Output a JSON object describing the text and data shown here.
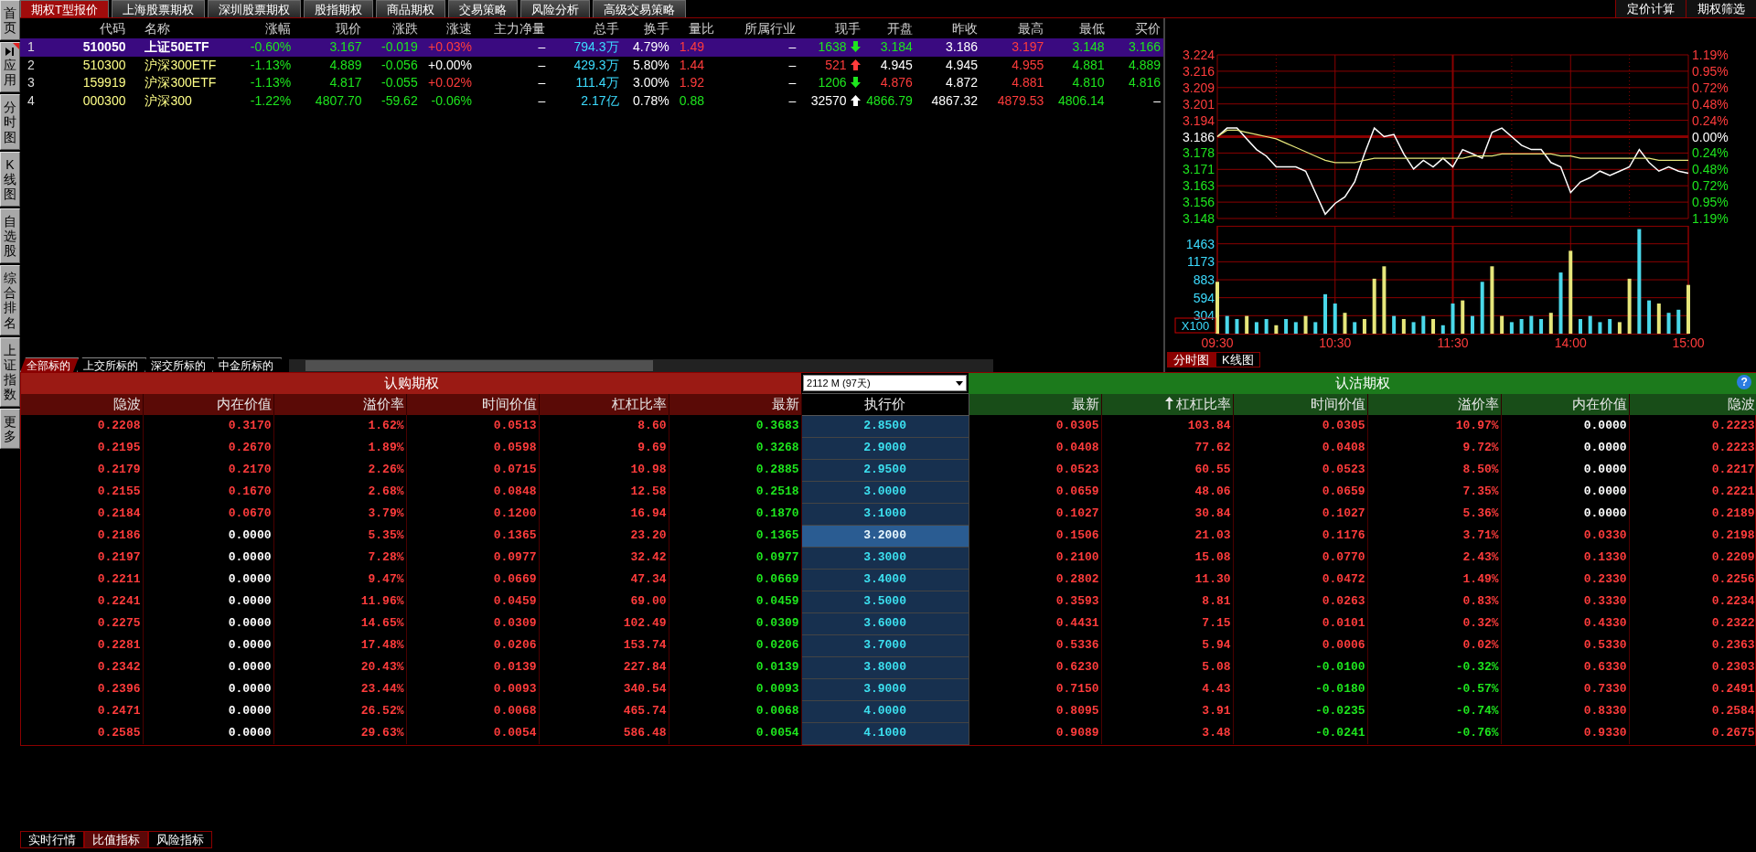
{
  "sidebar": {
    "items": [
      {
        "label": "首页",
        "kind": "tab"
      },
      {
        "label": "应用",
        "kind": "expand"
      },
      {
        "label": "分时图",
        "kind": "tab"
      },
      {
        "label": "K线图",
        "kind": "tab"
      },
      {
        "label": "自选股",
        "kind": "tab"
      },
      {
        "label": "综合排名",
        "kind": "tab"
      },
      {
        "label": "上证指数",
        "kind": "tab"
      },
      {
        "label": "更多",
        "kind": "tab"
      }
    ]
  },
  "top_tabs": [
    {
      "label": "期权T型报价",
      "selected": true
    },
    {
      "label": "上海股票期权",
      "selected": false
    },
    {
      "label": "深圳股票期权",
      "selected": false
    },
    {
      "label": "股指期权",
      "selected": false
    },
    {
      "label": "商品期权",
      "selected": false
    },
    {
      "label": "交易策略",
      "selected": false
    },
    {
      "label": "风险分析",
      "selected": false
    },
    {
      "label": "高级交易策略",
      "selected": false
    }
  ],
  "tools": [
    "定价计算",
    "期权筛选"
  ],
  "quote": {
    "columns": [
      "代码",
      "名称",
      "涨幅",
      "现价",
      "涨跌",
      "涨速",
      "主力净量",
      "总手",
      "换手",
      "量比",
      "所属行业",
      "现手",
      "开盘",
      "昨收",
      "最高",
      "最低",
      "买价"
    ],
    "rows": [
      {
        "index": "1",
        "selected": true,
        "cells": [
          {
            "text": "510050",
            "color": "#ffffff"
          },
          {
            "text": "上证50ETF",
            "color": "#ffffff"
          },
          {
            "text": "-0.60%",
            "color": "#1ee61e"
          },
          {
            "text": "3.167",
            "color": "#1ee61e"
          },
          {
            "text": "-0.019",
            "color": "#1ee61e"
          },
          {
            "text": "+0.03%",
            "color": "#ff3c3c"
          },
          {
            "text": "–",
            "color": "#ffffff"
          },
          {
            "text": "794.3万",
            "color": "#3cdcff"
          },
          {
            "text": "4.79%",
            "color": "#ffffff"
          },
          {
            "text": "1.49",
            "color": "#ff3c3c"
          },
          {
            "text": "–",
            "color": "#ffffff"
          },
          {
            "text": "1638",
            "color": "#1ee61e",
            "rising": false
          },
          {
            "text": "3.184",
            "color": "#1ee61e"
          },
          {
            "text": "3.186",
            "color": "#ffffff"
          },
          {
            "text": "3.197",
            "color": "#ff3c3c"
          },
          {
            "text": "3.148",
            "color": "#1ee61e"
          },
          {
            "text": "3.166",
            "color": "#1ee61e"
          }
        ]
      },
      {
        "index": "2",
        "selected": false,
        "cells": [
          {
            "text": "510300",
            "color": "#ffff88"
          },
          {
            "text": "沪深300ETF",
            "color": "#ffff88"
          },
          {
            "text": "-1.13%",
            "color": "#1ee61e"
          },
          {
            "text": "4.889",
            "color": "#1ee61e"
          },
          {
            "text": "-0.056",
            "color": "#1ee61e"
          },
          {
            "text": "+0.00%",
            "color": "#ffffff"
          },
          {
            "text": "–",
            "color": "#ffffff"
          },
          {
            "text": "429.3万",
            "color": "#3cdcff"
          },
          {
            "text": "5.80%",
            "color": "#ffffff"
          },
          {
            "text": "1.44",
            "color": "#ff3c3c"
          },
          {
            "text": "–",
            "color": "#ffffff"
          },
          {
            "text": "521",
            "color": "#ff3c3c",
            "rising": true
          },
          {
            "text": "4.945",
            "color": "#ffffff"
          },
          {
            "text": "4.945",
            "color": "#ffffff"
          },
          {
            "text": "4.955",
            "color": "#ff3c3c"
          },
          {
            "text": "4.881",
            "color": "#1ee61e"
          },
          {
            "text": "4.889",
            "color": "#1ee61e"
          }
        ]
      },
      {
        "index": "3",
        "selected": false,
        "cells": [
          {
            "text": "159919",
            "color": "#ffff88"
          },
          {
            "text": "沪深300ETF",
            "color": "#ffff88"
          },
          {
            "text": "-1.13%",
            "color": "#1ee61e"
          },
          {
            "text": "4.817",
            "color": "#1ee61e"
          },
          {
            "text": "-0.055",
            "color": "#1ee61e"
          },
          {
            "text": "+0.02%",
            "color": "#ff3c3c"
          },
          {
            "text": "–",
            "color": "#ffffff"
          },
          {
            "text": "111.4万",
            "color": "#3cdcff"
          },
          {
            "text": "3.00%",
            "color": "#ffffff"
          },
          {
            "text": "1.92",
            "color": "#ff3c3c"
          },
          {
            "text": "–",
            "color": "#ffffff"
          },
          {
            "text": "1206",
            "color": "#1ee61e",
            "rising": false
          },
          {
            "text": "4.876",
            "color": "#ff3c3c"
          },
          {
            "text": "4.872",
            "color": "#ffffff"
          },
          {
            "text": "4.881",
            "color": "#ff3c3c"
          },
          {
            "text": "4.810",
            "color": "#1ee61e"
          },
          {
            "text": "4.816",
            "color": "#1ee61e"
          }
        ]
      },
      {
        "index": "4",
        "selected": false,
        "cells": [
          {
            "text": "000300",
            "color": "#ffff88"
          },
          {
            "text": "沪深300",
            "color": "#ffff88"
          },
          {
            "text": "-1.22%",
            "color": "#1ee61e"
          },
          {
            "text": "4807.70",
            "color": "#1ee61e"
          },
          {
            "text": "-59.62",
            "color": "#1ee61e"
          },
          {
            "text": "-0.06%",
            "color": "#1ee61e"
          },
          {
            "text": "–",
            "color": "#ffffff"
          },
          {
            "text": "2.17亿",
            "color": "#3cdcff"
          },
          {
            "text": "0.78%",
            "color": "#ffffff"
          },
          {
            "text": "0.88",
            "color": "#1ee61e"
          },
          {
            "text": "–",
            "color": "#ffffff"
          },
          {
            "text": "32570",
            "color": "#ffffff",
            "rising": true
          },
          {
            "text": "4866.79",
            "color": "#1ee61e"
          },
          {
            "text": "4867.32",
            "color": "#ffffff"
          },
          {
            "text": "4879.53",
            "color": "#ff3c3c"
          },
          {
            "text": "4806.14",
            "color": "#1ee61e"
          },
          {
            "text": "–",
            "color": "#ffffff"
          }
        ]
      }
    ]
  },
  "underlying_tabs": [
    {
      "label": "全部标的",
      "selected": true
    },
    {
      "label": "上交所标的",
      "selected": false
    },
    {
      "label": "深交所标的",
      "selected": false
    },
    {
      "label": "中金所标的",
      "selected": false
    }
  ],
  "chart": {
    "price": {
      "right_labels": [
        {
          "text": "1.19%",
          "color": "#ff3c3c"
        },
        {
          "text": "0.95%",
          "color": "#ff3c3c"
        },
        {
          "text": "0.72%",
          "color": "#ff3c3c"
        },
        {
          "text": "0.48%",
          "color": "#ff3c3c"
        },
        {
          "text": "0.24%",
          "color": "#ff3c3c"
        },
        {
          "text": "0.00%",
          "color": "#ffffff"
        },
        {
          "text": "0.24%",
          "color": "#1ee61e"
        },
        {
          "text": "0.48%",
          "color": "#1ee61e"
        },
        {
          "text": "0.72%",
          "color": "#1ee61e"
        },
        {
          "text": "0.95%",
          "color": "#1ee61e"
        },
        {
          "text": "1.19%",
          "color": "#1ee61e"
        }
      ],
      "chart_data": {
        "type": "line",
        "ylim": [
          3.148,
          3.224
        ],
        "grid": true,
        "ref_lines": [
          {
            "axis": "y",
            "value": 3.186
          }
        ],
        "yticks": [
          {
            "value": 3.224,
            "label": "3.224"
          },
          {
            "value": 3.2164,
            "label": "3.216"
          },
          {
            "value": 3.2088,
            "label": "3.209"
          },
          {
            "value": 3.2012,
            "label": "3.201"
          },
          {
            "value": 3.1936,
            "label": "3.194"
          },
          {
            "value": 3.186,
            "label": "3.186"
          },
          {
            "value": 3.1784,
            "label": "3.178"
          },
          {
            "value": 3.1708,
            "label": "3.171"
          },
          {
            "value": 3.1632,
            "label": "3.163"
          },
          {
            "value": 3.1556,
            "label": "3.156"
          },
          {
            "value": 3.148,
            "label": "3.148"
          }
        ],
        "series": [
          {
            "color": "#ffffff",
            "values": [
              3.186,
              3.19,
              3.19,
              3.185,
              3.18,
              3.177,
              3.172,
              3.172,
              3.172,
              3.17,
              3.16,
              3.15,
              3.155,
              3.158,
              3.165,
              3.178,
              3.19,
              3.186,
              3.187,
              3.178,
              3.171,
              3.175,
              3.172,
              3.176,
              3.172,
              3.18,
              3.178,
              3.176,
              3.188,
              3.19,
              3.186,
              3.182,
              3.18,
              3.18,
              3.174,
              3.172,
              3.16,
              3.165,
              3.167,
              3.17,
              3.168,
              3.17,
              3.172,
              3.18,
              3.174,
              3.17,
              3.172,
              3.17,
              3.169
            ]
          },
          {
            "color": "#e6e67a",
            "values": [
              3.186,
              3.189,
              3.189,
              3.188,
              3.187,
              3.186,
              3.185,
              3.183,
              3.181,
              3.179,
              3.177,
              3.175,
              3.174,
              3.174,
              3.174,
              3.175,
              3.176,
              3.176,
              3.176,
              3.176,
              3.176,
              3.176,
              3.176,
              3.176,
              3.176,
              3.176,
              3.177,
              3.177,
              3.177,
              3.178,
              3.178,
              3.178,
              3.178,
              3.178,
              3.178,
              3.177,
              3.177,
              3.176,
              3.176,
              3.176,
              3.176,
              3.176,
              3.176,
              3.176,
              3.176,
              3.175,
              3.175,
              3.175,
              3.175
            ]
          }
        ]
      }
    },
    "volume": {
      "unit": "X100",
      "chart_data": {
        "type": "bar",
        "categories": [
          "09:30",
          null,
          null,
          null,
          null,
          null,
          null,
          null,
          null,
          null,
          null,
          null,
          "10:30",
          null,
          null,
          null,
          null,
          null,
          null,
          null,
          null,
          null,
          null,
          null,
          "11:30",
          null,
          null,
          null,
          null,
          null,
          null,
          null,
          null,
          null,
          null,
          null,
          "14:00",
          null,
          null,
          null,
          null,
          null,
          null,
          null,
          null,
          null,
          null,
          null,
          "15:00"
        ],
        "ylim": [
          14,
          1753
        ],
        "yticks": [
          304,
          594,
          883,
          1173,
          1463
        ],
        "grid": true,
        "series": [
          {
            "color": "#e6e67a",
            "values": [
              850,
              null,
              null,
              300,
              null,
              null,
              150,
              null,
              null,
              300,
              null,
              null,
              null,
              350,
              null,
              250,
              900,
              1100,
              null,
              250,
              null,
              null,
              250,
              null,
              null,
              550,
              null,
              null,
              1100,
              300,
              null,
              null,
              null,
              null,
              350,
              null,
              1350,
              null,
              null,
              null,
              null,
              200,
              900,
              null,
              null,
              500,
              null,
              null,
              800
            ]
          },
          {
            "color": "#4ad8ea",
            "values": [
              null,
              300,
              250,
              null,
              200,
              250,
              null,
              250,
              200,
              null,
              200,
              650,
              500,
              null,
              200,
              null,
              null,
              null,
              300,
              null,
              200,
              300,
              null,
              150,
              500,
              null,
              300,
              850,
              null,
              null,
              200,
              250,
              300,
              250,
              null,
              1000,
              null,
              250,
              300,
              200,
              250,
              null,
              null,
              1700,
              550,
              null,
              350,
              400,
              null
            ]
          }
        ]
      }
    },
    "tabs": [
      {
        "label": "分时图",
        "selected": true
      },
      {
        "label": "K线图",
        "selected": false
      }
    ]
  },
  "options": {
    "call_title": "认购期权",
    "put_title": "认沽期权",
    "expiry": "2112 M (97天)",
    "help": "?",
    "strike_column": "执行价",
    "call_columns": [
      {
        "label": "隐波",
        "sorted": false
      },
      {
        "label": "内在价值",
        "sorted": false
      },
      {
        "label": "溢价率",
        "sorted": false
      },
      {
        "label": "时间价值",
        "sorted": false
      },
      {
        "label": "杠杠比率",
        "sorted": false
      },
      {
        "label": "最新",
        "sorted": false
      }
    ],
    "put_columns": [
      {
        "label": "最新",
        "sorted": false
      },
      {
        "label": "杠杠比率",
        "sorted": true
      },
      {
        "label": "时间价值",
        "sorted": false
      },
      {
        "label": "溢价率",
        "sorted": false
      },
      {
        "label": "内在价值",
        "sorted": false
      },
      {
        "label": "隐波",
        "sorted": false
      }
    ],
    "rows": [
      {
        "strike": "2.8500",
        "selected": false,
        "call": [
          {
            "text": "0.2208",
            "color": "#ff3c3c"
          },
          {
            "text": "0.3170",
            "color": "#ff3c3c"
          },
          {
            "text": "1.62%",
            "color": "#ff3c3c"
          },
          {
            "text": "0.0513",
            "color": "#ff3c3c"
          },
          {
            "text": "8.60",
            "color": "#ff3c3c"
          },
          {
            "text": "0.3683",
            "color": "#1ee61e"
          }
        ],
        "put": [
          {
            "text": "0.0305",
            "color": "#ff3c3c"
          },
          {
            "text": "103.84",
            "color": "#ff3c3c"
          },
          {
            "text": "0.0305",
            "color": "#ff3c3c"
          },
          {
            "text": "10.97%",
            "color": "#ff3c3c"
          },
          {
            "text": "0.0000",
            "color": "#ffffff"
          },
          {
            "text": "0.2223",
            "color": "#ff3c3c"
          }
        ]
      },
      {
        "strike": "2.9000",
        "selected": false,
        "call": [
          {
            "text": "0.2195",
            "color": "#ff3c3c"
          },
          {
            "text": "0.2670",
            "color": "#ff3c3c"
          },
          {
            "text": "1.89%",
            "color": "#ff3c3c"
          },
          {
            "text": "0.0598",
            "color": "#ff3c3c"
          },
          {
            "text": "9.69",
            "color": "#ff3c3c"
          },
          {
            "text": "0.3268",
            "color": "#1ee61e"
          }
        ],
        "put": [
          {
            "text": "0.0408",
            "color": "#ff3c3c"
          },
          {
            "text": "77.62",
            "color": "#ff3c3c"
          },
          {
            "text": "0.0408",
            "color": "#ff3c3c"
          },
          {
            "text": "9.72%",
            "color": "#ff3c3c"
          },
          {
            "text": "0.0000",
            "color": "#ffffff"
          },
          {
            "text": "0.2223",
            "color": "#ff3c3c"
          }
        ]
      },
      {
        "strike": "2.9500",
        "selected": false,
        "call": [
          {
            "text": "0.2179",
            "color": "#ff3c3c"
          },
          {
            "text": "0.2170",
            "color": "#ff3c3c"
          },
          {
            "text": "2.26%",
            "color": "#ff3c3c"
          },
          {
            "text": "0.0715",
            "color": "#ff3c3c"
          },
          {
            "text": "10.98",
            "color": "#ff3c3c"
          },
          {
            "text": "0.2885",
            "color": "#1ee61e"
          }
        ],
        "put": [
          {
            "text": "0.0523",
            "color": "#ff3c3c"
          },
          {
            "text": "60.55",
            "color": "#ff3c3c"
          },
          {
            "text": "0.0523",
            "color": "#ff3c3c"
          },
          {
            "text": "8.50%",
            "color": "#ff3c3c"
          },
          {
            "text": "0.0000",
            "color": "#ffffff"
          },
          {
            "text": "0.2217",
            "color": "#ff3c3c"
          }
        ]
      },
      {
        "strike": "3.0000",
        "selected": false,
        "call": [
          {
            "text": "0.2155",
            "color": "#ff3c3c"
          },
          {
            "text": "0.1670",
            "color": "#ff3c3c"
          },
          {
            "text": "2.68%",
            "color": "#ff3c3c"
          },
          {
            "text": "0.0848",
            "color": "#ff3c3c"
          },
          {
            "text": "12.58",
            "color": "#ff3c3c"
          },
          {
            "text": "0.2518",
            "color": "#1ee61e"
          }
        ],
        "put": [
          {
            "text": "0.0659",
            "color": "#ff3c3c"
          },
          {
            "text": "48.06",
            "color": "#ff3c3c"
          },
          {
            "text": "0.0659",
            "color": "#ff3c3c"
          },
          {
            "text": "7.35%",
            "color": "#ff3c3c"
          },
          {
            "text": "0.0000",
            "color": "#ffffff"
          },
          {
            "text": "0.2221",
            "color": "#ff3c3c"
          }
        ]
      },
      {
        "strike": "3.1000",
        "selected": false,
        "call": [
          {
            "text": "0.2184",
            "color": "#ff3c3c"
          },
          {
            "text": "0.0670",
            "color": "#ff3c3c"
          },
          {
            "text": "3.79%",
            "color": "#ff3c3c"
          },
          {
            "text": "0.1200",
            "color": "#ff3c3c"
          },
          {
            "text": "16.94",
            "color": "#ff3c3c"
          },
          {
            "text": "0.1870",
            "color": "#1ee61e"
          }
        ],
        "put": [
          {
            "text": "0.1027",
            "color": "#ff3c3c"
          },
          {
            "text": "30.84",
            "color": "#ff3c3c"
          },
          {
            "text": "0.1027",
            "color": "#ff3c3c"
          },
          {
            "text": "5.36%",
            "color": "#ff3c3c"
          },
          {
            "text": "0.0000",
            "color": "#ffffff"
          },
          {
            "text": "0.2189",
            "color": "#ff3c3c"
          }
        ]
      },
      {
        "strike": "3.2000",
        "selected": true,
        "call": [
          {
            "text": "0.2186",
            "color": "#ff3c3c"
          },
          {
            "text": "0.0000",
            "color": "#ffffff"
          },
          {
            "text": "5.35%",
            "color": "#ff3c3c"
          },
          {
            "text": "0.1365",
            "color": "#ff3c3c"
          },
          {
            "text": "23.20",
            "color": "#ff3c3c"
          },
          {
            "text": "0.1365",
            "color": "#1ee61e"
          }
        ],
        "put": [
          {
            "text": "0.1506",
            "color": "#ff3c3c"
          },
          {
            "text": "21.03",
            "color": "#ff3c3c"
          },
          {
            "text": "0.1176",
            "color": "#ff3c3c"
          },
          {
            "text": "3.71%",
            "color": "#ff3c3c"
          },
          {
            "text": "0.0330",
            "color": "#ff3c3c"
          },
          {
            "text": "0.2198",
            "color": "#ff3c3c"
          }
        ]
      },
      {
        "strike": "3.3000",
        "selected": false,
        "call": [
          {
            "text": "0.2197",
            "color": "#ff3c3c"
          },
          {
            "text": "0.0000",
            "color": "#ffffff"
          },
          {
            "text": "7.28%",
            "color": "#ff3c3c"
          },
          {
            "text": "0.0977",
            "color": "#ff3c3c"
          },
          {
            "text": "32.42",
            "color": "#ff3c3c"
          },
          {
            "text": "0.0977",
            "color": "#1ee61e"
          }
        ],
        "put": [
          {
            "text": "0.2100",
            "color": "#ff3c3c"
          },
          {
            "text": "15.08",
            "color": "#ff3c3c"
          },
          {
            "text": "0.0770",
            "color": "#ff3c3c"
          },
          {
            "text": "2.43%",
            "color": "#ff3c3c"
          },
          {
            "text": "0.1330",
            "color": "#ff3c3c"
          },
          {
            "text": "0.2209",
            "color": "#ff3c3c"
          }
        ]
      },
      {
        "strike": "3.4000",
        "selected": false,
        "call": [
          {
            "text": "0.2211",
            "color": "#ff3c3c"
          },
          {
            "text": "0.0000",
            "color": "#ffffff"
          },
          {
            "text": "9.47%",
            "color": "#ff3c3c"
          },
          {
            "text": "0.0669",
            "color": "#ff3c3c"
          },
          {
            "text": "47.34",
            "color": "#ff3c3c"
          },
          {
            "text": "0.0669",
            "color": "#1ee61e"
          }
        ],
        "put": [
          {
            "text": "0.2802",
            "color": "#ff3c3c"
          },
          {
            "text": "11.30",
            "color": "#ff3c3c"
          },
          {
            "text": "0.0472",
            "color": "#ff3c3c"
          },
          {
            "text": "1.49%",
            "color": "#ff3c3c"
          },
          {
            "text": "0.2330",
            "color": "#ff3c3c"
          },
          {
            "text": "0.2256",
            "color": "#ff3c3c"
          }
        ]
      },
      {
        "strike": "3.5000",
        "selected": false,
        "call": [
          {
            "text": "0.2241",
            "color": "#ff3c3c"
          },
          {
            "text": "0.0000",
            "color": "#ffffff"
          },
          {
            "text": "11.96%",
            "color": "#ff3c3c"
          },
          {
            "text": "0.0459",
            "color": "#ff3c3c"
          },
          {
            "text": "69.00",
            "color": "#ff3c3c"
          },
          {
            "text": "0.0459",
            "color": "#1ee61e"
          }
        ],
        "put": [
          {
            "text": "0.3593",
            "color": "#ff3c3c"
          },
          {
            "text": "8.81",
            "color": "#ff3c3c"
          },
          {
            "text": "0.0263",
            "color": "#ff3c3c"
          },
          {
            "text": "0.83%",
            "color": "#ff3c3c"
          },
          {
            "text": "0.3330",
            "color": "#ff3c3c"
          },
          {
            "text": "0.2234",
            "color": "#ff3c3c"
          }
        ]
      },
      {
        "strike": "3.6000",
        "selected": false,
        "call": [
          {
            "text": "0.2275",
            "color": "#ff3c3c"
          },
          {
            "text": "0.0000",
            "color": "#ffffff"
          },
          {
            "text": "14.65%",
            "color": "#ff3c3c"
          },
          {
            "text": "0.0309",
            "color": "#ff3c3c"
          },
          {
            "text": "102.49",
            "color": "#ff3c3c"
          },
          {
            "text": "0.0309",
            "color": "#1ee61e"
          }
        ],
        "put": [
          {
            "text": "0.4431",
            "color": "#ff3c3c"
          },
          {
            "text": "7.15",
            "color": "#ff3c3c"
          },
          {
            "text": "0.0101",
            "color": "#ff3c3c"
          },
          {
            "text": "0.32%",
            "color": "#ff3c3c"
          },
          {
            "text": "0.4330",
            "color": "#ff3c3c"
          },
          {
            "text": "0.2322",
            "color": "#ff3c3c"
          }
        ]
      },
      {
        "strike": "3.7000",
        "selected": false,
        "call": [
          {
            "text": "0.2281",
            "color": "#ff3c3c"
          },
          {
            "text": "0.0000",
            "color": "#ffffff"
          },
          {
            "text": "17.48%",
            "color": "#ff3c3c"
          },
          {
            "text": "0.0206",
            "color": "#ff3c3c"
          },
          {
            "text": "153.74",
            "color": "#ff3c3c"
          },
          {
            "text": "0.0206",
            "color": "#1ee61e"
          }
        ],
        "put": [
          {
            "text": "0.5336",
            "color": "#ff3c3c"
          },
          {
            "text": "5.94",
            "color": "#ff3c3c"
          },
          {
            "text": "0.0006",
            "color": "#ff3c3c"
          },
          {
            "text": "0.02%",
            "color": "#ff3c3c"
          },
          {
            "text": "0.5330",
            "color": "#ff3c3c"
          },
          {
            "text": "0.2363",
            "color": "#ff3c3c"
          }
        ]
      },
      {
        "strike": "3.8000",
        "selected": false,
        "call": [
          {
            "text": "0.2342",
            "color": "#ff3c3c"
          },
          {
            "text": "0.0000",
            "color": "#ffffff"
          },
          {
            "text": "20.43%",
            "color": "#ff3c3c"
          },
          {
            "text": "0.0139",
            "color": "#ff3c3c"
          },
          {
            "text": "227.84",
            "color": "#ff3c3c"
          },
          {
            "text": "0.0139",
            "color": "#1ee61e"
          }
        ],
        "put": [
          {
            "text": "0.6230",
            "color": "#ff3c3c"
          },
          {
            "text": "5.08",
            "color": "#ff3c3c"
          },
          {
            "text": "-0.0100",
            "color": "#1ee61e"
          },
          {
            "text": "-0.32%",
            "color": "#1ee61e"
          },
          {
            "text": "0.6330",
            "color": "#ff3c3c"
          },
          {
            "text": "0.2303",
            "color": "#ff3c3c"
          }
        ]
      },
      {
        "strike": "3.9000",
        "selected": false,
        "call": [
          {
            "text": "0.2396",
            "color": "#ff3c3c"
          },
          {
            "text": "0.0000",
            "color": "#ffffff"
          },
          {
            "text": "23.44%",
            "color": "#ff3c3c"
          },
          {
            "text": "0.0093",
            "color": "#ff3c3c"
          },
          {
            "text": "340.54",
            "color": "#ff3c3c"
          },
          {
            "text": "0.0093",
            "color": "#1ee61e"
          }
        ],
        "put": [
          {
            "text": "0.7150",
            "color": "#ff3c3c"
          },
          {
            "text": "4.43",
            "color": "#ff3c3c"
          },
          {
            "text": "-0.0180",
            "color": "#1ee61e"
          },
          {
            "text": "-0.57%",
            "color": "#1ee61e"
          },
          {
            "text": "0.7330",
            "color": "#ff3c3c"
          },
          {
            "text": "0.2491",
            "color": "#ff3c3c"
          }
        ]
      },
      {
        "strike": "4.0000",
        "selected": false,
        "call": [
          {
            "text": "0.2471",
            "color": "#ff3c3c"
          },
          {
            "text": "0.0000",
            "color": "#ffffff"
          },
          {
            "text": "26.52%",
            "color": "#ff3c3c"
          },
          {
            "text": "0.0068",
            "color": "#ff3c3c"
          },
          {
            "text": "465.74",
            "color": "#ff3c3c"
          },
          {
            "text": "0.0068",
            "color": "#1ee61e"
          }
        ],
        "put": [
          {
            "text": "0.8095",
            "color": "#ff3c3c"
          },
          {
            "text": "3.91",
            "color": "#ff3c3c"
          },
          {
            "text": "-0.0235",
            "color": "#1ee61e"
          },
          {
            "text": "-0.74%",
            "color": "#1ee61e"
          },
          {
            "text": "0.8330",
            "color": "#ff3c3c"
          },
          {
            "text": "0.2584",
            "color": "#ff3c3c"
          }
        ]
      },
      {
        "strike": "4.1000",
        "selected": false,
        "call": [
          {
            "text": "0.2585",
            "color": "#ff3c3c"
          },
          {
            "text": "0.0000",
            "color": "#ffffff"
          },
          {
            "text": "29.63%",
            "color": "#ff3c3c"
          },
          {
            "text": "0.0054",
            "color": "#ff3c3c"
          },
          {
            "text": "586.48",
            "color": "#ff3c3c"
          },
          {
            "text": "0.0054",
            "color": "#1ee61e"
          }
        ],
        "put": [
          {
            "text": "0.9089",
            "color": "#ff3c3c"
          },
          {
            "text": "3.48",
            "color": "#ff3c3c"
          },
          {
            "text": "-0.0241",
            "color": "#1ee61e"
          },
          {
            "text": "-0.76%",
            "color": "#1ee61e"
          },
          {
            "text": "0.9330",
            "color": "#ff3c3c"
          },
          {
            "text": "0.2675",
            "color": "#ff3c3c"
          }
        ]
      }
    ]
  },
  "bottom_tabs": [
    {
      "label": "实时行情",
      "selected": false
    },
    {
      "label": "比值指标",
      "selected": true
    },
    {
      "label": "风险指标",
      "selected": false
    }
  ]
}
